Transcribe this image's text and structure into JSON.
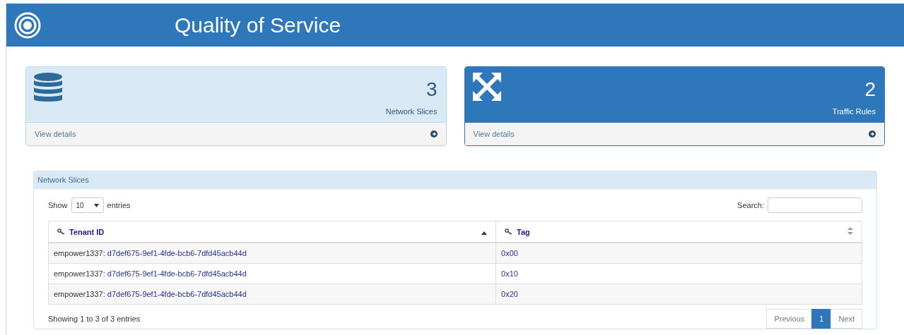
{
  "header": {
    "title": "Quality of Service"
  },
  "cards": [
    {
      "kind": "light",
      "count": "3",
      "label": "Network Slices",
      "link": "View details"
    },
    {
      "kind": "primary",
      "count": "2",
      "label": "Traffic Rules",
      "link": "View details"
    }
  ],
  "panel": {
    "title": "Network Slices",
    "length_label_before": "Show",
    "length_value": "10",
    "length_label_after": "entries",
    "search_label": "Search:",
    "columns": [
      {
        "label": "Tenant ID",
        "sorted": true
      },
      {
        "label": "Tag",
        "sorted": false
      }
    ],
    "rows": [
      {
        "owner": "empower1337:",
        "tenant_id": "d7def675-9ef1-4fde-bcb6-7dfd45acb44d",
        "tag": "0x00"
      },
      {
        "owner": "empower1337:",
        "tenant_id": "d7def675-9ef1-4fde-bcb6-7dfd45acb44d",
        "tag": "0x10"
      },
      {
        "owner": "empower1337:",
        "tenant_id": "d7def675-9ef1-4fde-bcb6-7dfd45acb44d",
        "tag": "0x20"
      }
    ],
    "info": "Showing 1 to 3 of 3 entries",
    "pagination": [
      {
        "label": "Previous",
        "selected": false
      },
      {
        "label": "1",
        "selected": true
      },
      {
        "label": "Next",
        "selected": false
      }
    ]
  }
}
